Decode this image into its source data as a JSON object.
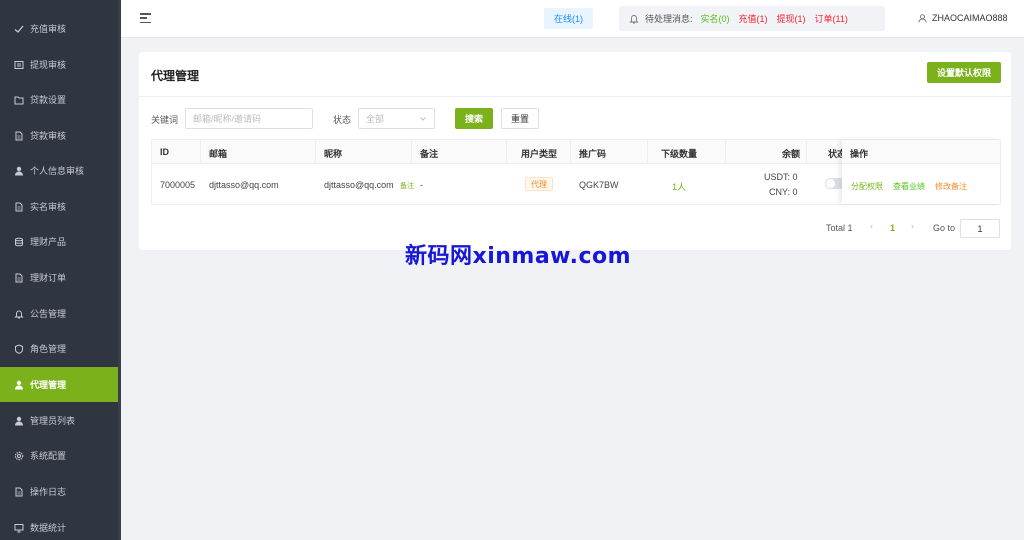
{
  "sidebar": {
    "items": [
      {
        "label": "充值审核",
        "icon": "check-icon"
      },
      {
        "label": "提现审核",
        "icon": "withdraw-icon"
      },
      {
        "label": "贷款设置",
        "icon": "folder-icon"
      },
      {
        "label": "贷款审核",
        "icon": "document-icon"
      },
      {
        "label": "个人信息审核",
        "icon": "user-icon"
      },
      {
        "label": "实名审核",
        "icon": "document-icon"
      },
      {
        "label": "理财产品",
        "icon": "database-icon"
      },
      {
        "label": "理财订单",
        "icon": "document-icon"
      },
      {
        "label": "公告管理",
        "icon": "bell-icon"
      },
      {
        "label": "角色管理",
        "icon": "shield-icon"
      },
      {
        "label": "代理管理",
        "icon": "user-icon",
        "active": true
      },
      {
        "label": "管理员列表",
        "icon": "user-icon"
      },
      {
        "label": "系统配置",
        "icon": "gear-icon"
      },
      {
        "label": "操作日志",
        "icon": "document-icon"
      },
      {
        "label": "数据统计",
        "icon": "monitor-icon"
      }
    ]
  },
  "header": {
    "online": "在线(1)",
    "pending_label": "待处理消息:",
    "pending": {
      "realname": "实名(0)",
      "recharge": "充值(1)",
      "withdraw": "提现(1)",
      "order": "订单(11)"
    },
    "username": "ZHAOCAIMAO888"
  },
  "page": {
    "title": "代理管理",
    "set_default_perm": "设置默认权限"
  },
  "filters": {
    "keyword_label": "关键词",
    "keyword_placeholder": "邮箱/昵称/邀请码",
    "status_label": "状态",
    "status_value": "全部",
    "search_btn": "搜索",
    "reset_btn": "重置"
  },
  "table": {
    "headers": {
      "id": "ID",
      "email": "邮箱",
      "nickname": "昵称",
      "remark": "备注",
      "user_type": "用户类型",
      "promo_code": "推广码",
      "sub_count": "下级数量",
      "balance": "余额",
      "status": "状态",
      "actions": "操作"
    },
    "rows": [
      {
        "id": "7000005",
        "email": "djttasso@qq.com",
        "nickname": "djttasso@qq.com",
        "nickname_tag": "备注",
        "remark": "-",
        "user_type": "代理",
        "promo_code": "QGK7BW",
        "sub_count": "1人",
        "balance_usdt": "USDT: 0",
        "balance_cny": "CNY: 0",
        "status_on": false,
        "actions": {
          "assign": "分配权限",
          "performance": "查看业绩",
          "edit_remark": "修改备注"
        }
      }
    ]
  },
  "pagination": {
    "total": "Total 1",
    "current_page": "1",
    "goto_label": "Go to",
    "goto_value": "1"
  },
  "watermark": "新码网xinmaw.com",
  "colors": {
    "accent": "#7bb21c",
    "sidebar_bg": "#2f3541",
    "online_blue": "#1890ff",
    "success": "#52c41a",
    "danger": "#f5222d",
    "warning": "#f28b2b"
  }
}
